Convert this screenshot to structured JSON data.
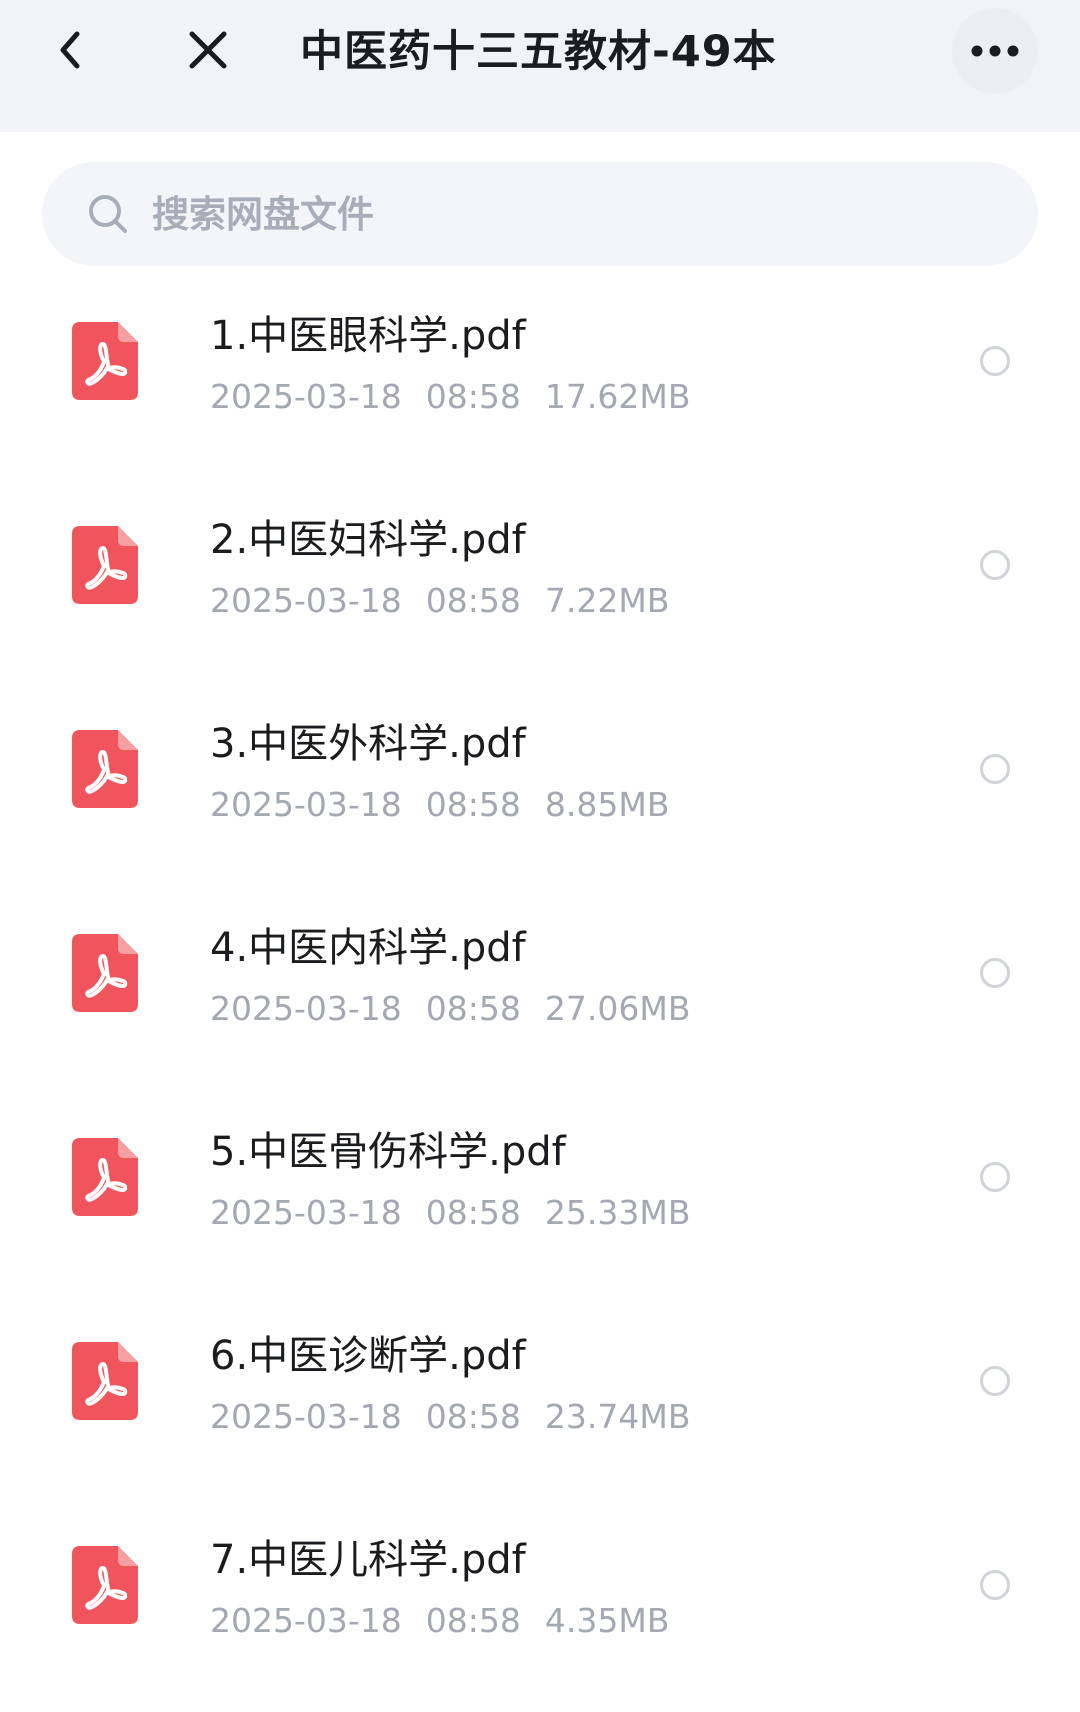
{
  "header": {
    "title": "中医药十三五教材-49本",
    "back_icon": "chevron-left-icon",
    "close_icon": "close-icon",
    "more_icon": "more-horizontal-icon"
  },
  "search": {
    "placeholder": "搜索网盘文件",
    "icon": "search-icon"
  },
  "colors": {
    "header_bg": "#f2f3f7",
    "pdf_icon": "#f0555d",
    "meta_text": "#a4a8b3",
    "radio_border": "#d0d3d9"
  },
  "files": [
    {
      "name": "1.中医眼科学.pdf",
      "date": "2025-03-18",
      "time": "08:58",
      "size": "17.62MB",
      "icon": "pdf-file-icon"
    },
    {
      "name": "2.中医妇科学.pdf",
      "date": "2025-03-18",
      "time": "08:58",
      "size": "7.22MB",
      "icon": "pdf-file-icon"
    },
    {
      "name": "3.中医外科学.pdf",
      "date": "2025-03-18",
      "time": "08:58",
      "size": "8.85MB",
      "icon": "pdf-file-icon"
    },
    {
      "name": "4.中医内科学.pdf",
      "date": "2025-03-18",
      "time": "08:58",
      "size": "27.06MB",
      "icon": "pdf-file-icon"
    },
    {
      "name": "5.中医骨伤科学.pdf",
      "date": "2025-03-18",
      "time": "08:58",
      "size": "25.33MB",
      "icon": "pdf-file-icon"
    },
    {
      "name": "6.中医诊断学.pdf",
      "date": "2025-03-18",
      "time": "08:58",
      "size": "23.74MB",
      "icon": "pdf-file-icon"
    },
    {
      "name": "7.中医儿科学.pdf",
      "date": "2025-03-18",
      "time": "08:58",
      "size": "4.35MB",
      "icon": "pdf-file-icon"
    }
  ]
}
